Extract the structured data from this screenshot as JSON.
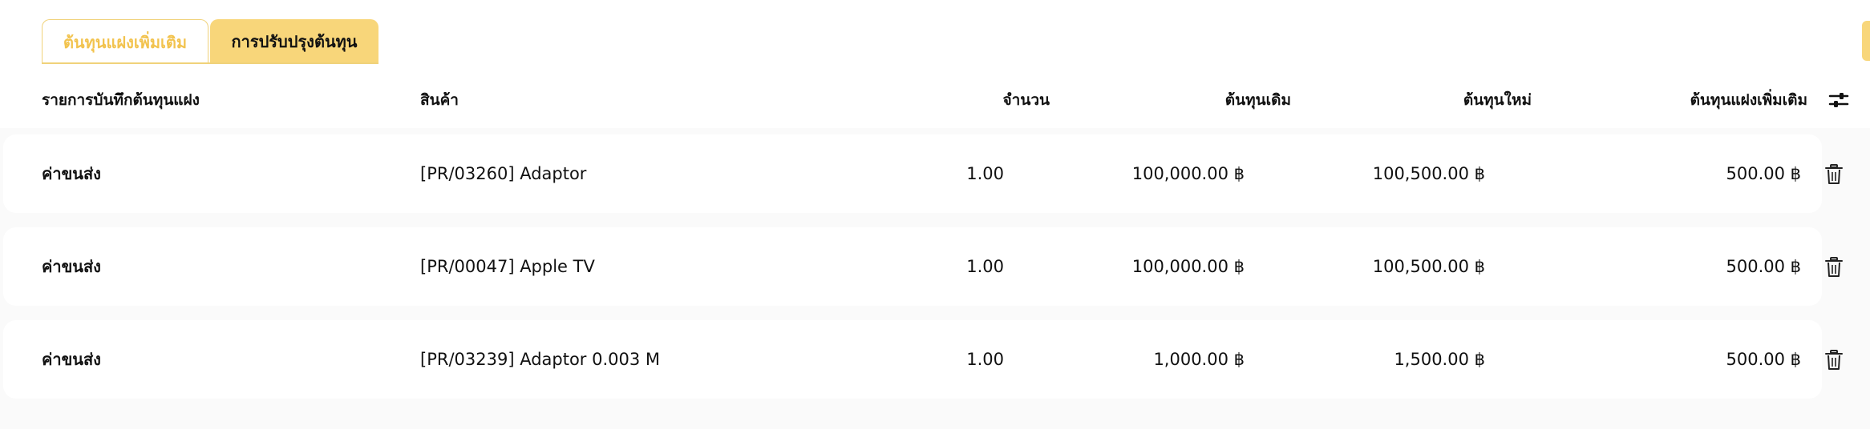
{
  "tabs": [
    {
      "label": "ต้นทุนแฝงเพิ่มเติม"
    },
    {
      "label": "การปรับปรุงต้นทุน"
    }
  ],
  "table": {
    "headers": {
      "record": "รายการบันทึกต้นทุนแฝง",
      "product": "สินค้า",
      "quantity": "จำนวน",
      "old_cost": "ต้นทุนเดิม",
      "new_cost": "ต้นทุนใหม่",
      "added_cost": "ต้นทุนแฝงเพิ่มเติม"
    },
    "rows": [
      {
        "record": "ค่าขนส่ง",
        "product": "[PR/03260] Adaptor",
        "quantity": "1.00",
        "old_cost": "100,000.00 ฿",
        "new_cost": "100,500.00 ฿",
        "added_cost": "500.00 ฿"
      },
      {
        "record": "ค่าขนส่ง",
        "product": "[PR/00047] Apple TV",
        "quantity": "1.00",
        "old_cost": "100,000.00 ฿",
        "new_cost": "100,500.00 ฿",
        "added_cost": "500.00 ฿"
      },
      {
        "record": "ค่าขนส่ง",
        "product": "[PR/03239] Adaptor 0.003 M",
        "quantity": "1.00",
        "old_cost": "1,000.00 ฿",
        "new_cost": "1,500.00 ฿",
        "added_cost": "500.00 ฿"
      }
    ]
  },
  "icons": {
    "settings": "sliders-icon",
    "delete": "trash-icon"
  },
  "colors": {
    "accent": "#f8d67a",
    "accent_text": "#f2c34e"
  }
}
